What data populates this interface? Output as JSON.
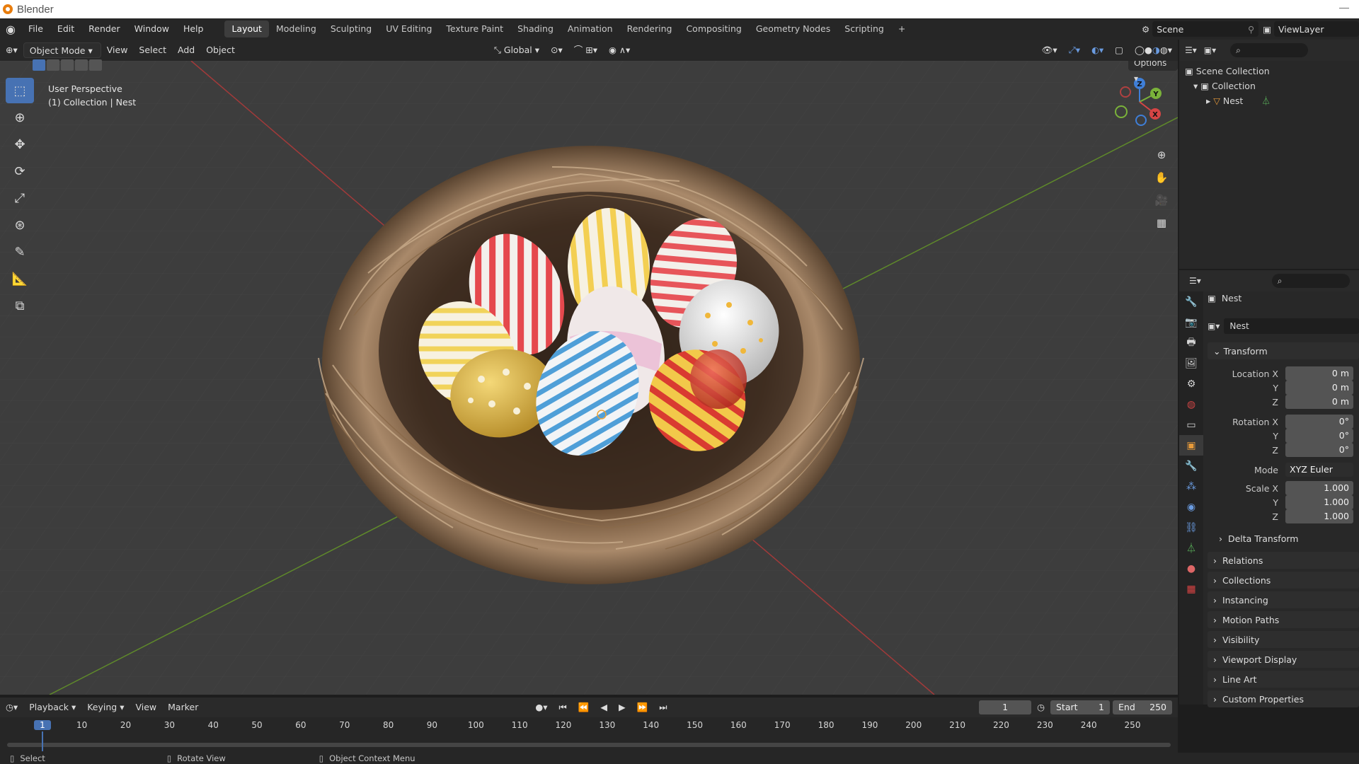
{
  "app": {
    "title": "Blender"
  },
  "menu": [
    "File",
    "Edit",
    "Render",
    "Window",
    "Help"
  ],
  "workspaces": [
    "Layout",
    "Modeling",
    "Sculpting",
    "UV Editing",
    "Texture Paint",
    "Shading",
    "Animation",
    "Rendering",
    "Compositing",
    "Geometry Nodes",
    "Scripting"
  ],
  "workspace_add": "+",
  "scene": {
    "name": "Scene",
    "view_layer": "ViewLayer"
  },
  "viewport_header": {
    "mode": "Object Mode",
    "menus": [
      "View",
      "Select",
      "Add",
      "Object"
    ],
    "transform_orientation": "Global",
    "options": "Options"
  },
  "viewport": {
    "perspective": "User Perspective",
    "collection_info": "(1) Collection | Nest"
  },
  "gizmo": {
    "x": "X",
    "y": "Y",
    "z": "Z"
  },
  "outliner": {
    "root": "Scene Collection",
    "collection": "Collection",
    "object": "Nest"
  },
  "properties": {
    "object_name": "Nest",
    "data_name": "Nest",
    "panel_transform": "Transform",
    "location_label": "Location X",
    "y_label": "Y",
    "z_label": "Z",
    "rotation_label": "Rotation X",
    "mode_label": "Mode",
    "scale_label": "Scale X",
    "location": {
      "x": "0 m",
      "y": "0 m",
      "z": "0 m"
    },
    "rotation": {
      "x": "0°",
      "y": "0°",
      "z": "0°"
    },
    "rotation_mode": "XYZ Euler",
    "scale": {
      "x": "1.000",
      "y": "1.000",
      "z": "1.000"
    },
    "subpanel": "Delta Transform",
    "panels": [
      "Relations",
      "Collections",
      "Instancing",
      "Motion Paths",
      "Visibility",
      "Viewport Display",
      "Line Art",
      "Custom Properties"
    ]
  },
  "timeline": {
    "menus": [
      "Playback",
      "Keying",
      "View",
      "Marker"
    ],
    "current_frame": "1",
    "start_label": "Start",
    "start": "1",
    "end_label": "End",
    "end": "250",
    "ticks": [
      "1",
      "10",
      "20",
      "30",
      "40",
      "50",
      "60",
      "70",
      "80",
      "90",
      "100",
      "110",
      "120",
      "130",
      "140",
      "150",
      "160",
      "170",
      "180",
      "190",
      "200",
      "210",
      "220",
      "230",
      "240",
      "250"
    ]
  },
  "statusbar": {
    "left": "Select",
    "middle": "Rotate View",
    "right": "Object Context Menu"
  },
  "colors": {
    "accent": "#4772b3",
    "axis_x": "#c43a3a",
    "axis_y": "#6a9a2a",
    "nest": "#7a5a3a"
  }
}
